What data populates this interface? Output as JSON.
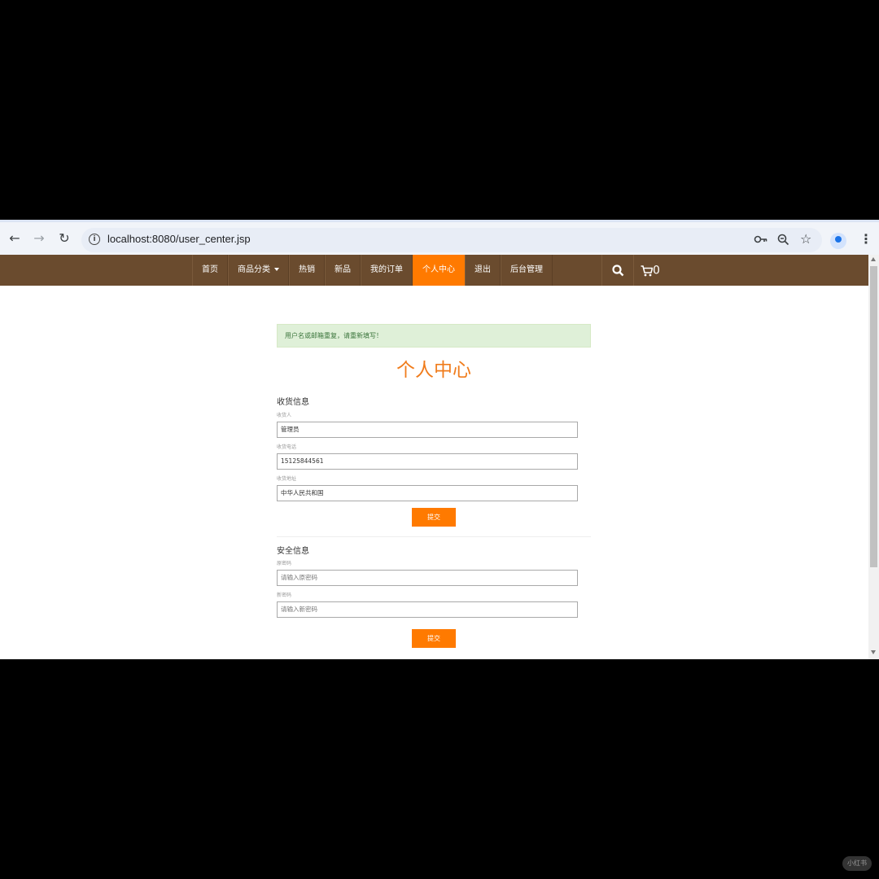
{
  "browser": {
    "url": "localhost:8080/user_center.jsp",
    "icons": [
      "back-arrow-icon",
      "forward-arrow-icon",
      "reload-icon",
      "info-icon",
      "key-icon",
      "zoom-icon",
      "star-icon",
      "profile-icon",
      "menu-icon"
    ]
  },
  "nav": {
    "items": [
      {
        "label": "首页"
      },
      {
        "label": "商品分类",
        "has_caret": true
      },
      {
        "label": "热销"
      },
      {
        "label": "新品"
      },
      {
        "label": "我的订单"
      },
      {
        "label": "个人中心",
        "active": true
      },
      {
        "label": "退出"
      },
      {
        "label": "后台管理"
      }
    ],
    "cart_count": "0",
    "background": "#6a4b2e",
    "accent": "#ff7a00"
  },
  "alert": {
    "text": "用户名或邮箱重复，请重新填写！"
  },
  "page": {
    "title": "个人中心"
  },
  "shipping": {
    "title": "收货信息",
    "name_label": "收货人",
    "name_value": "管理员",
    "phone_label": "收货电话",
    "phone_value": "15125844561",
    "address_label": "收货地址",
    "address_value": "中华人民共和国",
    "submit": "提交"
  },
  "security": {
    "title": "安全信息",
    "old_label": "原密码",
    "old_placeholder": "请输入原密码",
    "new_label": "新密码",
    "new_placeholder": "请输入新密码",
    "submit": "提交"
  },
  "watermark": "小红书"
}
